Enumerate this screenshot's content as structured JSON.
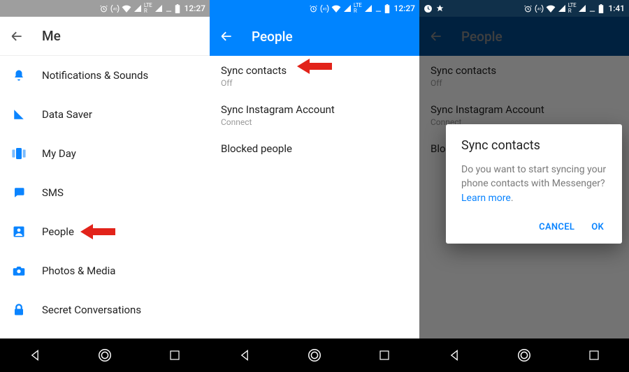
{
  "status": {
    "time_a": "12:27",
    "time_b": "12:27",
    "time_c": "1:41",
    "lte_top": "LTE",
    "lte_r": "R"
  },
  "screen1": {
    "title": "Me",
    "items": [
      {
        "label": "Notifications & Sounds",
        "icon": "bell-icon"
      },
      {
        "label": "Data Saver",
        "icon": "signal-icon"
      },
      {
        "label": "My Day",
        "icon": "story-icon"
      },
      {
        "label": "SMS",
        "icon": "chat-icon"
      },
      {
        "label": "People",
        "icon": "person-icon"
      },
      {
        "label": "Photos & Media",
        "icon": "camera-icon"
      },
      {
        "label": "Secret Conversations",
        "icon": "lock-icon"
      }
    ]
  },
  "screen2": {
    "title": "People",
    "items": [
      {
        "label": "Sync contacts",
        "sub": "Off"
      },
      {
        "label": "Sync Instagram Account",
        "sub": "Connect"
      },
      {
        "label": "Blocked people",
        "sub": ""
      }
    ]
  },
  "screen3": {
    "title": "People",
    "items": [
      {
        "label": "Sync contacts",
        "sub": "Off"
      },
      {
        "label": "Sync Instagram Account",
        "sub": "Connect"
      },
      {
        "label": "Blocked people",
        "sub": ""
      }
    ],
    "dialog": {
      "title": "Sync contacts",
      "body": "Do you want to start syncing your phone contacts with Messenger? ",
      "learn": "Learn more",
      "cancel": "CANCEL",
      "ok": "OK"
    }
  }
}
